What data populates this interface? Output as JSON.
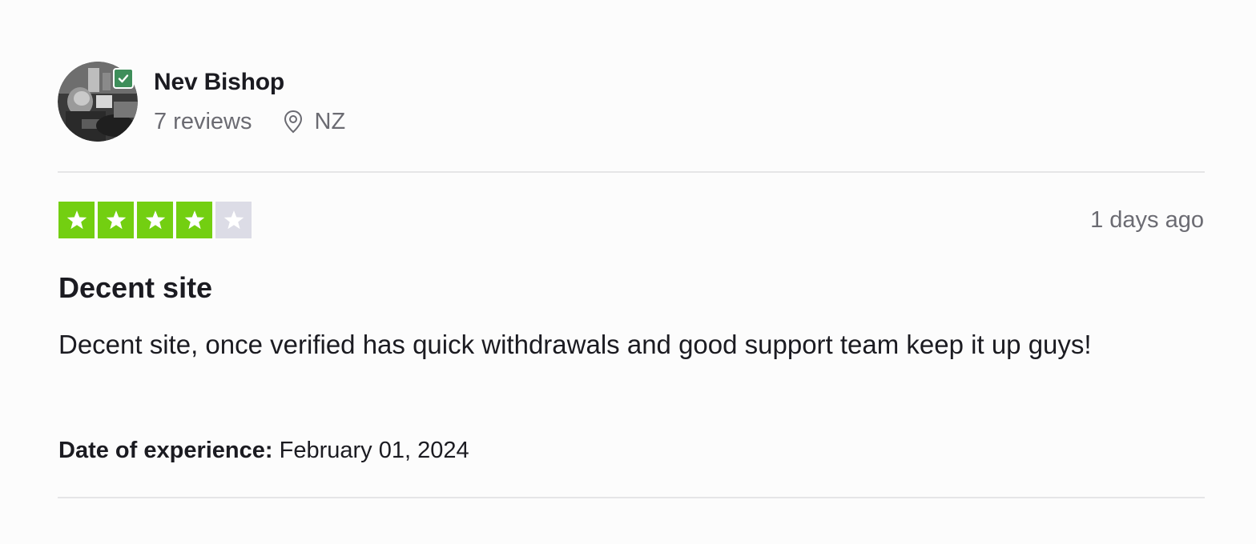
{
  "reviewer": {
    "name": "Nev Bishop",
    "reviews_count": "7 reviews",
    "location": "NZ",
    "verified": true,
    "avatar_icon": "user-photo"
  },
  "review": {
    "rating": 4,
    "rating_max": 5,
    "date": "1 days ago",
    "title": "Decent site",
    "body": "Decent site, once verified has quick withdrawals and good support team keep it up guys!",
    "experience_label": "Date of experience:",
    "experience_date": "February 01, 2024"
  },
  "colors": {
    "star_filled": "#73cf11",
    "star_empty": "#dcdce6",
    "verified_badge": "#3e8e5a"
  },
  "icons": {
    "location": "map-pin-icon",
    "verified": "verified-check-icon",
    "star": "star-icon"
  }
}
